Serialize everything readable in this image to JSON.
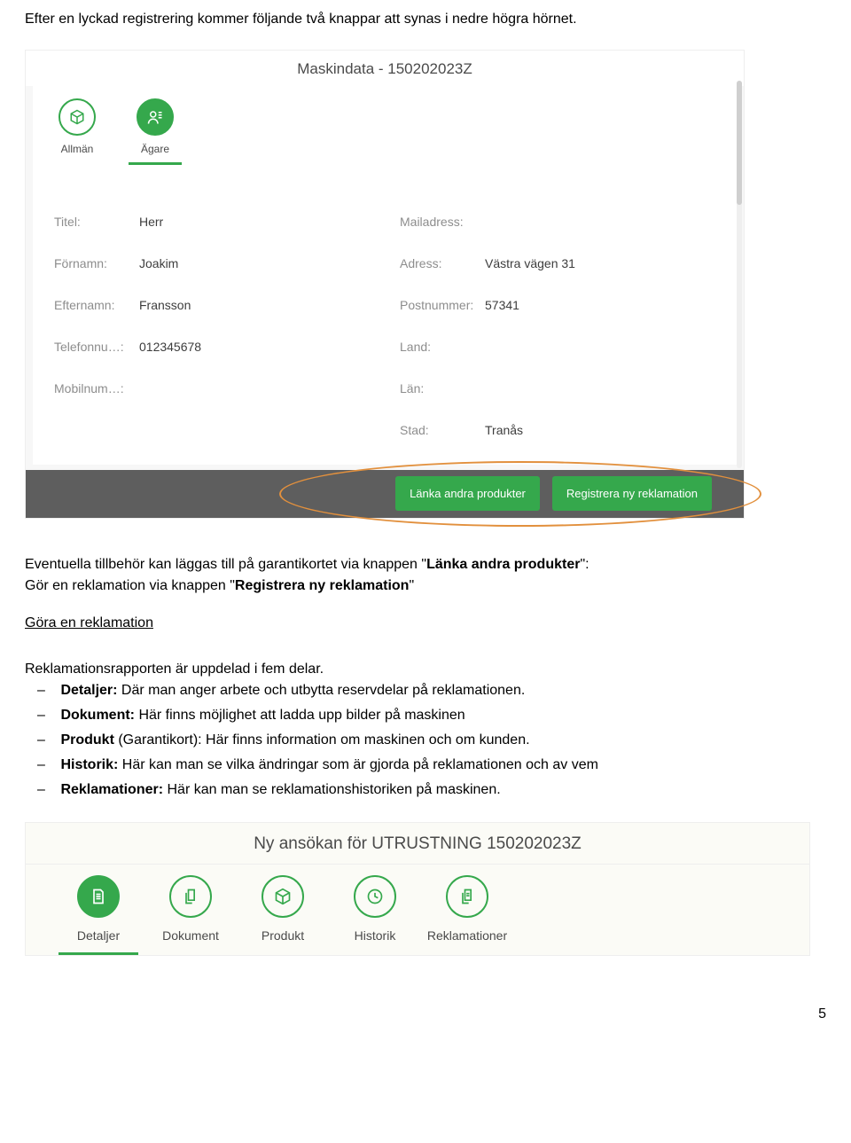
{
  "page_number": "5",
  "intro": "Efter en lyckad registrering kommer följande två knappar att synas i nedre högra hörnet.",
  "ss1": {
    "title": "Maskindata - 150202023Z",
    "tabs": [
      {
        "label": "Allmän"
      },
      {
        "label": "Ägare"
      }
    ],
    "fields_left": [
      {
        "label": "Titel:",
        "value": "Herr"
      },
      {
        "label": "Förnamn:",
        "value": "Joakim"
      },
      {
        "label": "Efternamn:",
        "value": "Fransson"
      },
      {
        "label": "Telefonnu…:",
        "value": "012345678"
      },
      {
        "label": "Mobilnum…:",
        "value": ""
      }
    ],
    "fields_right": [
      {
        "label": "Mailadress:",
        "value": ""
      },
      {
        "label": "Adress:",
        "value": "Västra vägen 31"
      },
      {
        "label": "Postnummer:",
        "value": "57341"
      },
      {
        "label": "Land:",
        "value": ""
      },
      {
        "label": "Län:",
        "value": ""
      },
      {
        "label": "Stad:",
        "value": "Tranås"
      }
    ],
    "buttons": {
      "link_products": "Länka andra produkter",
      "register_claim": "Registrera ny reklamation"
    }
  },
  "text": {
    "para1a": "Eventuella tillbehör kan läggas till på garantikortet via knappen \"",
    "bold1": "Länka andra produkter",
    "para1b": "\":",
    "para2a": "Gör en reklamation via knappen \"",
    "bold2": "Registrera ny reklamation",
    "para2b": "\"",
    "heading": "Göra en reklamation",
    "para3": "Reklamationsrapporten är uppdelad i fem delar.",
    "bullets": [
      {
        "bold": "Detaljer: ",
        "rest": "Där man anger arbete och utbytta reservdelar på reklamationen."
      },
      {
        "bold": "Dokument: ",
        "rest": "Här finns möjlighet att ladda upp bilder på maskinen"
      },
      {
        "bold": "Produkt ",
        "rest": "(Garantikort): Här finns information om maskinen och om kunden."
      },
      {
        "bold": "Historik: ",
        "rest": "Här kan man se vilka ändringar som är gjorda på reklamationen och av vem"
      },
      {
        "bold": "Reklamationer: ",
        "rest": "Här kan man se reklamationshistoriken på maskinen."
      }
    ]
  },
  "ss2": {
    "title": "Ny ansökan för UTRUSTNING 150202023Z",
    "tabs": [
      {
        "label": "Detaljer"
      },
      {
        "label": "Dokument"
      },
      {
        "label": "Produkt"
      },
      {
        "label": "Historik"
      },
      {
        "label": "Reklamationer"
      }
    ]
  }
}
